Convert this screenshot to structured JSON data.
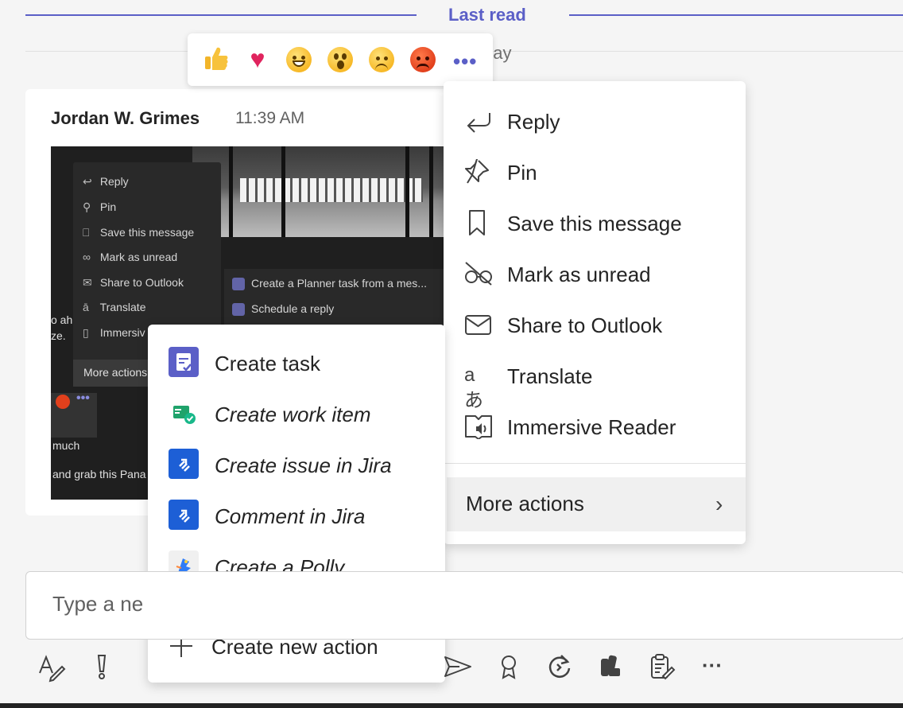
{
  "divider": {
    "label": "Last read",
    "day_partial": "day"
  },
  "reactions": {
    "items": [
      "like",
      "heart",
      "laugh",
      "surprised",
      "sad",
      "angry"
    ],
    "more_label": "•••"
  },
  "message": {
    "author": "Jordan W. Grimes",
    "time": "11:39 AM",
    "image": {
      "menu_items": [
        "Reply",
        "Pin",
        "Save this message",
        "Mark as unread",
        "Share to Outlook",
        "Translate",
        "Immersiv"
      ],
      "more_actions": "More actions",
      "sub_items": [
        "Create a Planner task from a mes...",
        "Schedule a reply"
      ],
      "fragments": [
        "o ah",
        "ze.",
        "much",
        "and grab this Pana"
      ]
    }
  },
  "context_menu": {
    "items": [
      {
        "label": "Reply",
        "icon": "reply-icon"
      },
      {
        "label": "Pin",
        "icon": "pin-icon"
      },
      {
        "label": "Save this message",
        "icon": "bookmark-icon"
      },
      {
        "label": "Mark as unread",
        "icon": "glasses-slash-icon"
      },
      {
        "label": "Share to Outlook",
        "icon": "mail-icon"
      },
      {
        "label": "Translate",
        "icon": "translate-icon"
      },
      {
        "label": "Immersive Reader",
        "icon": "immersive-reader-icon"
      }
    ],
    "more_actions": "More actions"
  },
  "more_actions_menu": {
    "items": [
      {
        "label": "Create task",
        "app": "planner"
      },
      {
        "label": "Create work item",
        "app": "azure-boards"
      },
      {
        "label": "Create issue in Jira",
        "app": "jira"
      },
      {
        "label": "Comment in Jira",
        "app": "jira"
      },
      {
        "label": "Create a Polly",
        "app": "polly"
      }
    ],
    "create_new": "Create new action"
  },
  "compose": {
    "placeholder": "Type a ne"
  },
  "colors": {
    "accent": "#5b5fc7",
    "planner": "#5b5fc7",
    "jira": "#1d5fd6",
    "boards": "#19a974"
  }
}
